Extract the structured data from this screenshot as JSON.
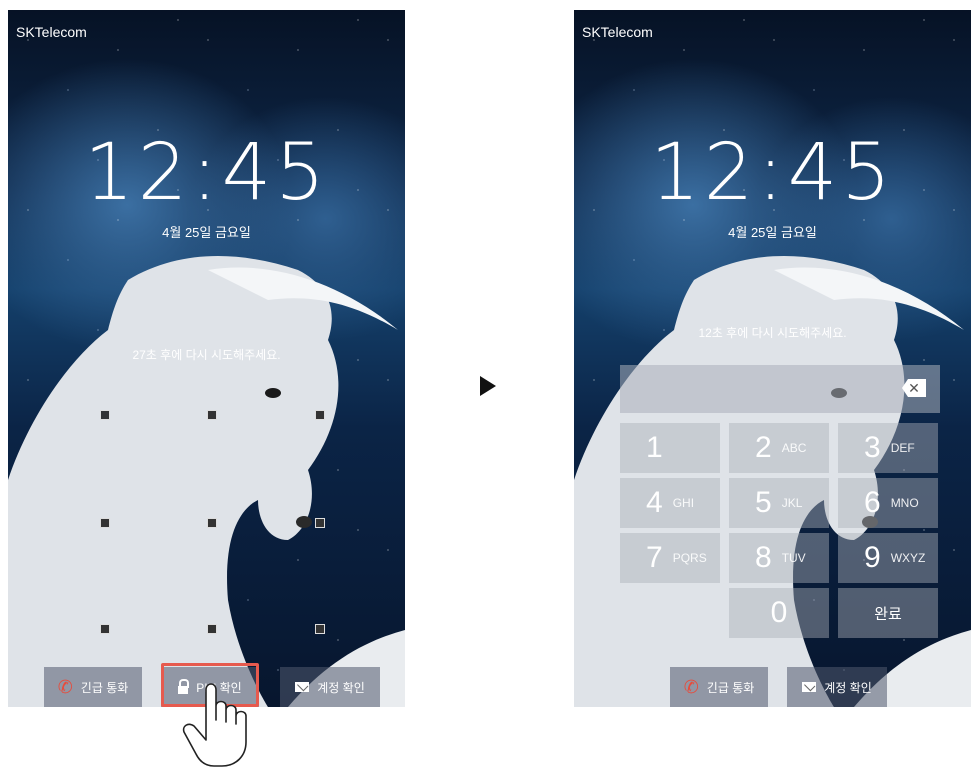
{
  "left_screen": {
    "carrier": "SKTelecom",
    "time": "12:45",
    "date": "4월 25일 금요일",
    "retry_message": "27초 후에 다시 시도해주세요.",
    "buttons": {
      "emergency_call": "긴급 통화",
      "pin_confirm": "PIN 확인",
      "account_confirm": "계정 확인"
    }
  },
  "right_screen": {
    "carrier": "SKTelecom",
    "time": "12:45",
    "date": "4월 25일 금요일",
    "retry_message": "12초 후에 다시 시도해주세요.",
    "keypad": [
      {
        "num": "1",
        "letters": ""
      },
      {
        "num": "2",
        "letters": "ABC"
      },
      {
        "num": "3",
        "letters": "DEF"
      },
      {
        "num": "4",
        "letters": "GHI"
      },
      {
        "num": "5",
        "letters": "JKL"
      },
      {
        "num": "6",
        "letters": "MNO"
      },
      {
        "num": "7",
        "letters": "PQRS"
      },
      {
        "num": "8",
        "letters": "TUV"
      },
      {
        "num": "9",
        "letters": "WXYZ"
      },
      {
        "num": "0",
        "letters": ""
      }
    ],
    "done_label": "완료",
    "backspace_label": "✕",
    "buttons": {
      "emergency_call": "긴급 통화",
      "account_confirm": "계정 확인"
    }
  },
  "colors": {
    "highlight": "#e65a4e",
    "phone_icon": "#e74c3c"
  }
}
